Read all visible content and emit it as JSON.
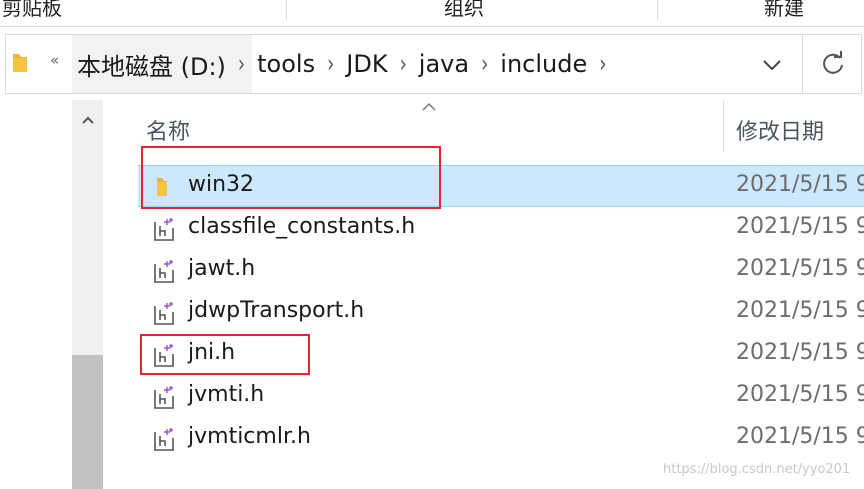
{
  "ribbon": {
    "groups": [
      "剪贴板",
      "组织",
      "新建"
    ]
  },
  "address": {
    "overflow": "«",
    "crumbs": [
      "本地磁盘 (D:)",
      "tools",
      "JDK",
      "java",
      "include"
    ],
    "separator": "›"
  },
  "columns": {
    "name": "名称",
    "date": "修改日期"
  },
  "files": [
    {
      "name": "win32",
      "date": "2021/5/15 9",
      "type": "folder",
      "selected": true
    },
    {
      "name": "classfile_constants.h",
      "date": "2021/5/15 9",
      "type": "header"
    },
    {
      "name": "jawt.h",
      "date": "2021/5/15 9",
      "type": "header"
    },
    {
      "name": "jdwpTransport.h",
      "date": "2021/5/15 9",
      "type": "header"
    },
    {
      "name": "jni.h",
      "date": "2021/5/15 9",
      "type": "header"
    },
    {
      "name": "jvmti.h",
      "date": "2021/5/15 9",
      "type": "header"
    },
    {
      "name": "jvmticmlr.h",
      "date": "2021/5/15 9",
      "type": "header"
    }
  ],
  "watermark": "https://blog.csdn.net/yyo201",
  "colors": {
    "selection": "#cce8ff",
    "annotation": "#e0282e",
    "folder": "#f6c343"
  },
  "icons": {
    "folder": "folder-icon",
    "header": "header-file-icon",
    "refresh": "refresh-icon",
    "dropdown": "chevron-down-icon"
  }
}
